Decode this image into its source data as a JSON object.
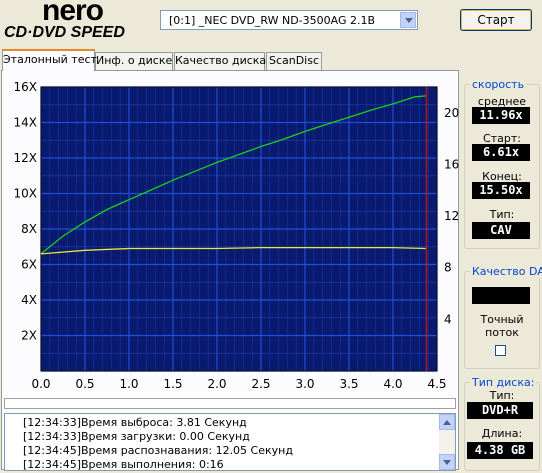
{
  "app": {
    "logo_top": "nero",
    "logo_bottom": "CD·DVD SPEED"
  },
  "drive_select": {
    "value": "[0:1]  _NEC DVD_RW ND-3500AG 2.1B"
  },
  "start_button": {
    "label": "Старт"
  },
  "tabs": [
    {
      "label": "Эталонный тест",
      "active": true
    },
    {
      "label": "Инф. о диске",
      "active": false
    },
    {
      "label": "Качество диска",
      "active": false
    },
    {
      "label": "ScanDisc",
      "active": false
    }
  ],
  "speed_panel": {
    "title": "скорость",
    "average_label": "среднее",
    "average_value": "11.96x",
    "start_label": "Старт:",
    "start_value": "6.61x",
    "end_label": "Конец:",
    "end_value": "15.50x",
    "type_label": "Тип:",
    "type_value": "CAV"
  },
  "dae_panel": {
    "title": "Качество DAE",
    "accurate_label": "Точный\nпоток",
    "accurate_checked": false
  },
  "disc_panel": {
    "title": "Тип диска:",
    "type_label": "Тип:",
    "type_value": "DVD+R",
    "length_label": "Длина:",
    "length_value": "4.38 GB"
  },
  "progress": {
    "fraction": 0.0
  },
  "log": [
    {
      "time": "[12:34:33]",
      "msg": "Время выброса: 3.81 Секунд"
    },
    {
      "time": "[12:34:33]",
      "msg": "Время загрузки: 0.00 Секунд"
    },
    {
      "time": "[12:34:45]",
      "msg": "Время распознавания: 12.05 Секунд"
    },
    {
      "time": "[12:34:45]",
      "msg": "Время выполнения: 0:16"
    }
  ],
  "colors": {
    "plot_bg": "#0a1a6e",
    "grid": "#1f4fd6",
    "speed_line": "#19d019",
    "rpm_line": "#e8e830",
    "end_marker": "#d01010",
    "value_text": "#ffffff"
  },
  "chart_data": {
    "type": "line",
    "x_ticks": [
      "0.0",
      "0.5",
      "1.0",
      "1.5",
      "2.0",
      "2.5",
      "3.0",
      "3.5",
      "4.0",
      "4.5"
    ],
    "y_left_ticks": [
      "2X",
      "4X",
      "6X",
      "8X",
      "10X",
      "12X",
      "14X",
      "16X"
    ],
    "y_right_ticks": [
      "4",
      "8",
      "12",
      "16",
      "20"
    ],
    "xlim": [
      0,
      4.5
    ],
    "ylim_left": [
      0,
      16
    ],
    "ylim_right": [
      0,
      22
    ],
    "grid": true,
    "series": [
      {
        "axis": "left",
        "color": "speed",
        "x": [
          0,
          0.25,
          0.5,
          0.75,
          1.0,
          1.25,
          1.5,
          1.75,
          2.0,
          2.25,
          2.5,
          2.75,
          3.0,
          3.25,
          3.5,
          3.75,
          4.0,
          4.25,
          4.38
        ],
        "y": [
          6.61,
          7.6,
          8.4,
          9.1,
          9.65,
          10.2,
          10.75,
          11.25,
          11.75,
          12.2,
          12.65,
          13.05,
          13.5,
          13.9,
          14.3,
          14.7,
          15.05,
          15.45,
          15.5
        ]
      },
      {
        "axis": "left",
        "color": "rpm",
        "x": [
          0,
          0.5,
          1.0,
          1.5,
          2.0,
          2.5,
          3.0,
          3.5,
          4.0,
          4.38
        ],
        "y": [
          6.6,
          6.8,
          6.9,
          6.9,
          6.9,
          6.95,
          6.95,
          6.95,
          6.95,
          6.9
        ]
      }
    ],
    "end_marker_x": 4.38
  }
}
